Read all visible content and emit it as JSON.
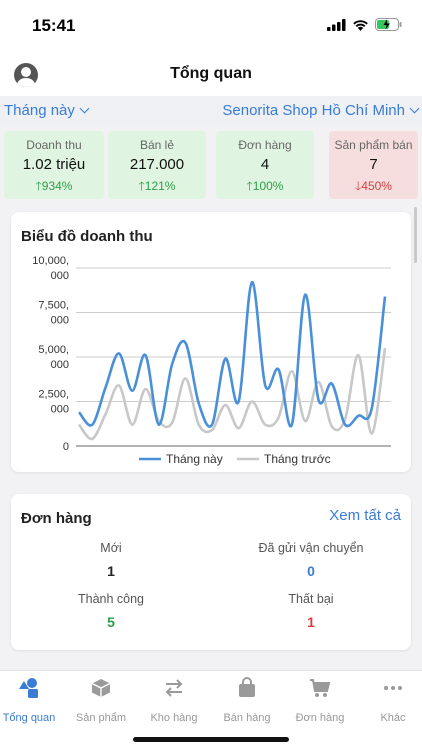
{
  "status_bar": {
    "time": "15:41"
  },
  "header": {
    "title": "Tổng quan"
  },
  "filters": {
    "period": "Tháng này",
    "shop": "Senorita Shop Hồ Chí Minh"
  },
  "kpis": [
    {
      "label": "Doanh thu",
      "value": "1.02 triệu",
      "change": "934%",
      "trend": "up"
    },
    {
      "label": "Bán lẻ",
      "value": "217.000",
      "change": "121%",
      "trend": "up"
    },
    {
      "label": "Đơn hàng",
      "value": "4",
      "change": "100%",
      "trend": "up"
    },
    {
      "label": "Sản phẩm bán",
      "value": "7",
      "change": "450%",
      "trend": "down"
    }
  ],
  "revenue_chart": {
    "title": "Biểu đồ doanh thu"
  },
  "chart_data": {
    "type": "line",
    "title": "Biểu đồ doanh thu",
    "ylim": [
      0,
      10000
    ],
    "yticks": [
      "10,000,\n000",
      "7,500,\n000",
      "5,000,\n000",
      "2,500,\n000",
      "0"
    ],
    "ytick_values": [
      10000000,
      7500000,
      5000000,
      2500000,
      0
    ],
    "grid": true,
    "legend_position": "bottom",
    "series": [
      {
        "name": "Tháng này",
        "color": "#4a90d9",
        "values": [
          1900000,
          1200000,
          3300000,
          5200000,
          3100000,
          5100000,
          1200000,
          4600000,
          5800000,
          2400000,
          1200000,
          4900000,
          2500000,
          9200000,
          3400000,
          4300000,
          1200000,
          8500000,
          2600000,
          3500000,
          1200000,
          1700000,
          2100000,
          8400000
        ]
      },
      {
        "name": "Tháng trước",
        "color": "#c8c8c8",
        "values": [
          1200000,
          400000,
          1800000,
          3400000,
          1200000,
          3200000,
          1400000,
          1300000,
          3800000,
          1200000,
          900000,
          2300000,
          1000000,
          2500000,
          1200000,
          1600000,
          4200000,
          1400000,
          3600000,
          1100000,
          1500000,
          5100000,
          700000,
          5500000
        ]
      }
    ]
  },
  "orders": {
    "title": "Đơn hàng",
    "see_all": "Xem tất cả",
    "stats": [
      {
        "label": "Mới",
        "value": "1",
        "color": "#222222"
      },
      {
        "label": "Đã gửi vận chuyển",
        "value": "0",
        "color": "#3a7bd5"
      },
      {
        "label": "Thành công",
        "value": "5",
        "color": "#2e9e47"
      },
      {
        "label": "Thất bại",
        "value": "1",
        "color": "#d64040"
      }
    ]
  },
  "tabs": [
    {
      "label": "Tổng quan",
      "icon": "dashboard-shapes-icon",
      "active": true
    },
    {
      "label": "Sản phẩm",
      "icon": "box-icon",
      "active": false
    },
    {
      "label": "Kho hàng",
      "icon": "transfer-arrows-icon",
      "active": false
    },
    {
      "label": "Bán hàng",
      "icon": "shopping-bag-icon",
      "active": false
    },
    {
      "label": "Đơn hàng",
      "icon": "cart-icon",
      "active": false
    },
    {
      "label": "Khác",
      "icon": "more-dots-icon",
      "active": false
    }
  ],
  "colors": {
    "accent": "#3a7bd5",
    "up": "#2e9e47",
    "down": "#d64040",
    "up_bg": "#dff5e1",
    "down_bg": "#f7dede"
  }
}
